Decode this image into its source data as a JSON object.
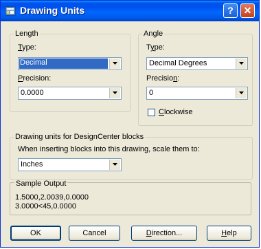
{
  "window": {
    "title": "Drawing Units"
  },
  "length": {
    "legend": "Length",
    "type_label_u": "T",
    "type_label_rest": "ype:",
    "type_value": "Decimal",
    "precision_label_u": "P",
    "precision_label_rest": "recision:",
    "precision_value": "0.0000"
  },
  "angle": {
    "legend": "Angle",
    "type_label_pre": "T",
    "type_label_u": "y",
    "type_label_rest": "pe:",
    "type_value": "Decimal Degrees",
    "precision_label_pre": "Precisio",
    "precision_label_u": "n",
    "precision_label_rest": ":",
    "precision_value": "0",
    "clockwise_u": "C",
    "clockwise_rest": "lockwise",
    "clockwise_checked": false
  },
  "designcenter": {
    "legend": "Drawing units for DesignCenter blocks",
    "instruction": "When inserting blocks into this drawing, scale them to:",
    "units_value": "Inches"
  },
  "sample": {
    "legend": "Sample Output",
    "line1": "1.5000,2.0039,0.0000",
    "line2": "3.0000<45,0.0000"
  },
  "buttons": {
    "ok": "OK",
    "cancel": "Cancel",
    "direction_u": "D",
    "direction_rest": "irection...",
    "help_u": "H",
    "help_rest": "elp"
  },
  "colors": {
    "titlebar": "#0058e8",
    "dialog_bg": "#ece9d8",
    "selection": "#316ac5"
  }
}
